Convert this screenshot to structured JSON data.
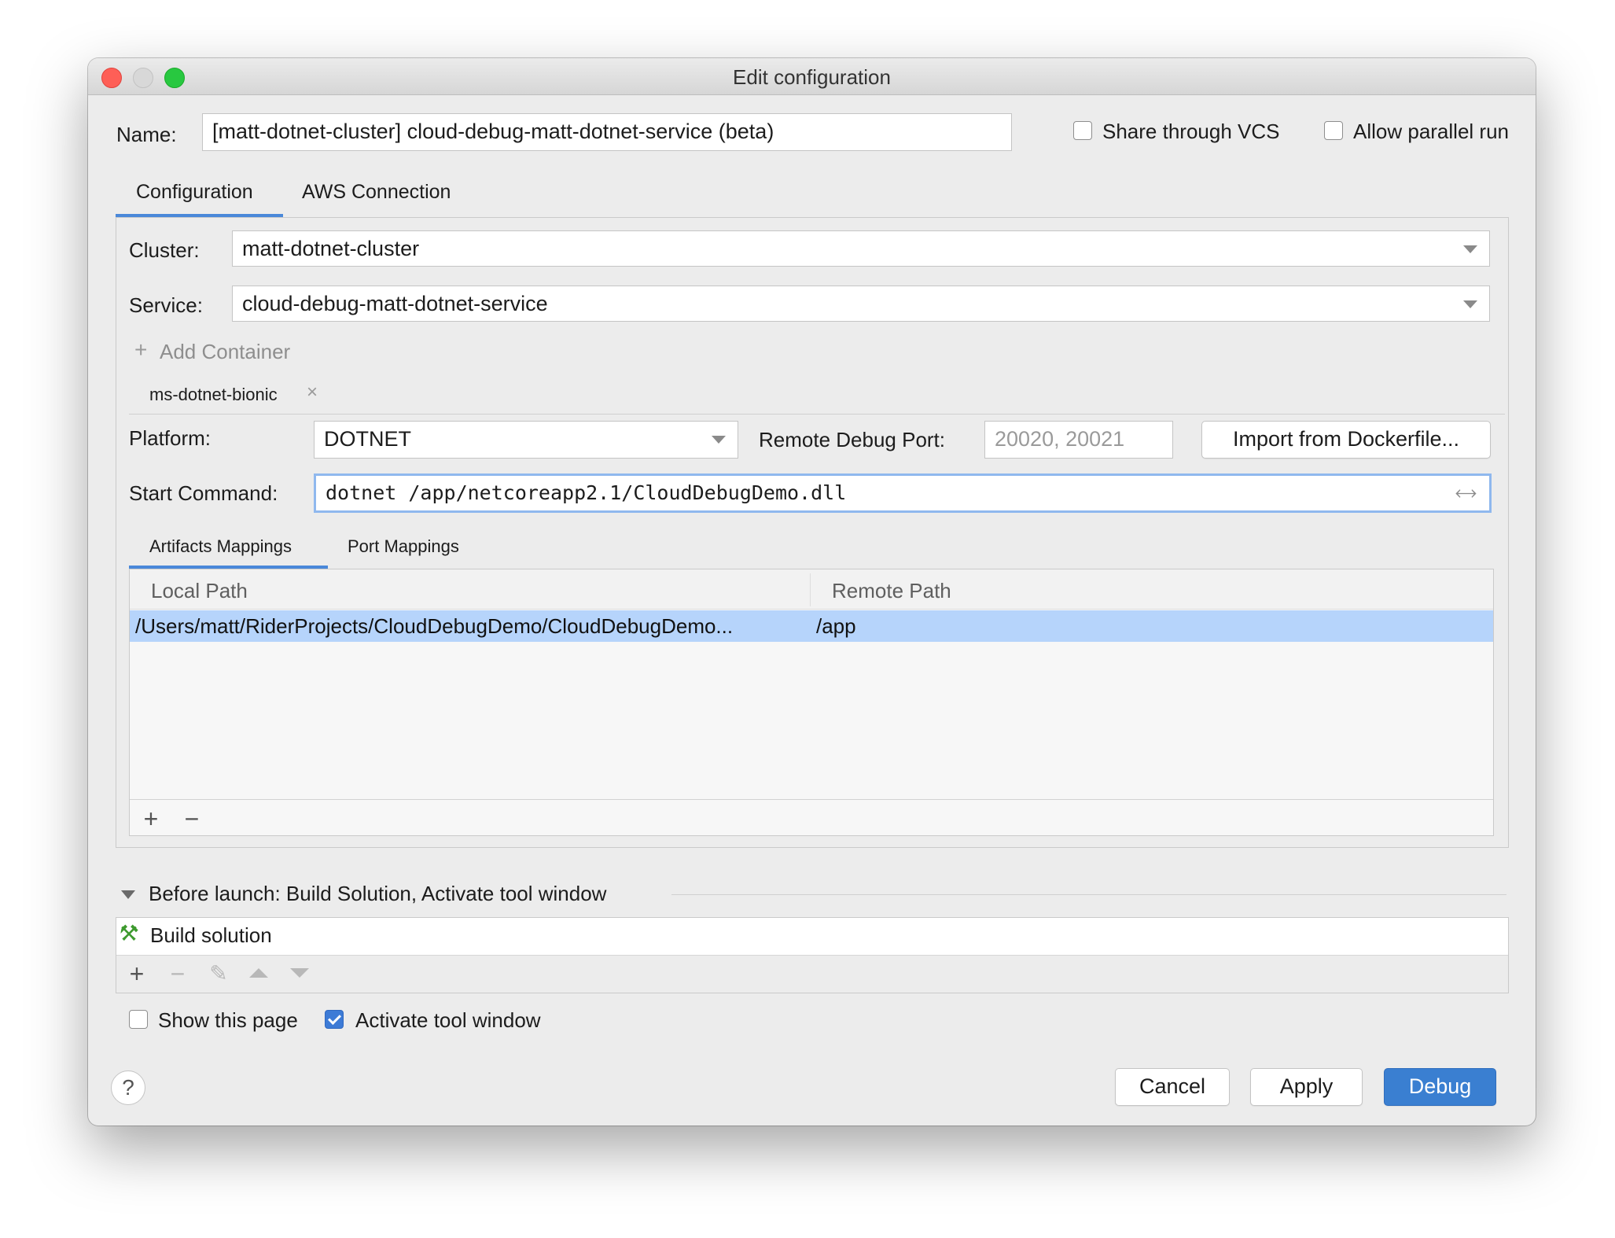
{
  "window": {
    "title": "Edit configuration"
  },
  "header": {
    "name_label": "Name:",
    "name_value": "[matt-dotnet-cluster] cloud-debug-matt-dotnet-service (beta)",
    "share_vcs_label": "Share through VCS",
    "share_vcs_checked": false,
    "allow_parallel_label": "Allow parallel run",
    "allow_parallel_checked": false
  },
  "tabs": [
    {
      "label": "Configuration",
      "active": true
    },
    {
      "label": "AWS Connection",
      "active": false
    }
  ],
  "config": {
    "cluster_label": "Cluster:",
    "cluster_value": "matt-dotnet-cluster",
    "service_label": "Service:",
    "service_value": "cloud-debug-matt-dotnet-service",
    "add_container_label": "Add Container",
    "container_tab": "ms-dotnet-bionic",
    "platform_label": "Platform:",
    "platform_value": "DOTNET",
    "remote_port_label": "Remote Debug Port:",
    "remote_port_placeholder": "20020, 20021",
    "import_button": "Import from Dockerfile...",
    "start_command_label": "Start Command:",
    "start_command_value": "dotnet /app/netcoreapp2.1/CloudDebugDemo.dll"
  },
  "mapping_tabs": [
    {
      "label": "Artifacts Mappings",
      "active": true
    },
    {
      "label": "Port Mappings",
      "active": false
    }
  ],
  "mappings_table": {
    "columns": [
      "Local Path",
      "Remote Path"
    ],
    "rows": [
      {
        "local": "/Users/matt/RiderProjects/CloudDebugDemo/CloudDebugDemo...",
        "remote": "/app",
        "selected": true
      }
    ],
    "add_symbol": "+",
    "remove_symbol": "−"
  },
  "before_launch": {
    "header": "Before launch: Build Solution, Activate tool window",
    "items": [
      "Build solution"
    ],
    "show_page_label": "Show this page",
    "show_page_checked": false,
    "activate_label": "Activate tool window",
    "activate_checked": true
  },
  "footer": {
    "help_symbol": "?",
    "cancel": "Cancel",
    "apply": "Apply",
    "debug": "Debug"
  },
  "colors": {
    "accent": "#4a88d9",
    "selection": "#b6d4fb",
    "primary_button": "#3a7fd1"
  }
}
